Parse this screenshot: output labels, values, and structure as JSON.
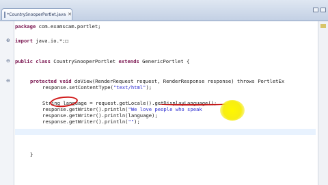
{
  "editor": {
    "tab": {
      "title": "*CountrySnooperPortlet.java",
      "close_glyph": "✕"
    },
    "fold_markers": [
      "⊖",
      "⊕",
      "⊖",
      "⊖"
    ],
    "lines": {
      "package": {
        "kw": "package",
        "rest": " com.examscam.portlet;"
      },
      "import": {
        "kw": "import",
        "rest": " java.io.*;",
        "folded": "□"
      },
      "class_decl": {
        "kw1": "public class",
        "mid": " CountrySnooperPortlet ",
        "kw2": "extends",
        "rest": " GenericPortlet {"
      },
      "method_decl": {
        "kw": "protected void",
        "rest": " doView(RenderRequest request, RenderResponse response) throws PortletEx"
      },
      "set_content": {
        "pre": "response.setContentType(",
        "str": "\"text/html\"",
        "post": ");"
      },
      "string_decl": {
        "pre": "String ",
        "var": "language",
        "mid": " = request.getLocale()",
        "dot": ".",
        "call": "getDisplayLanguage()",
        "post": ";"
      },
      "println1": {
        "pre": "response.getWriter().println(",
        "str": "\"We love people who speak",
        "post": ""
      },
      "println2": {
        "text": "response.getWriter().println(language);"
      },
      "println3": {
        "pre": "response.getWriter().println(",
        "str": "\"\"",
        "post": ");"
      },
      "close_brace": {
        "text": "}"
      }
    }
  },
  "colors": {
    "keyword": "#7a1650",
    "string": "#2a2ad0",
    "circle": "#d01818",
    "highlight": "#fff700"
  },
  "icons": [
    "file-icon",
    "close-icon",
    "minimize-icon",
    "maximize-icon",
    "fold-toggle-icon"
  ]
}
